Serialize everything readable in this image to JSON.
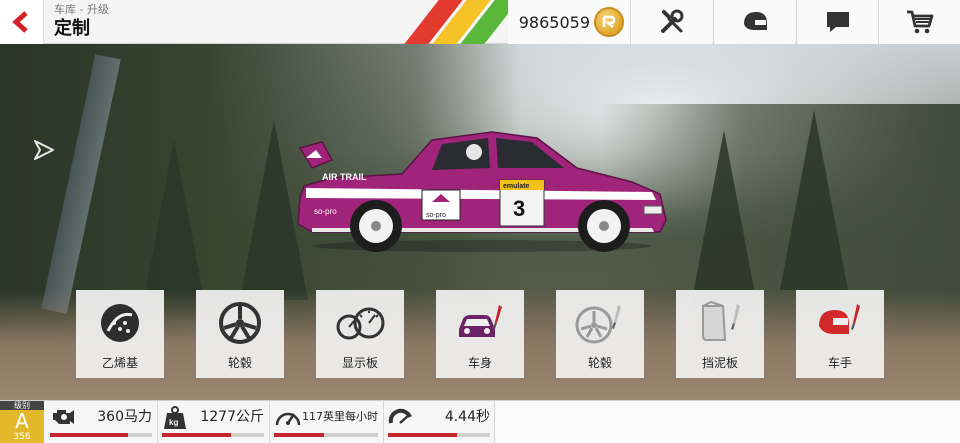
{
  "header": {
    "breadcrumb": "车库 - 升级",
    "title": "定制",
    "currency": "9865059",
    "stripe_colors": [
      "#e23a2f",
      "#f5c227",
      "#59b73a"
    ]
  },
  "nav": [
    {
      "name": "tools",
      "icon": "wrench-screwdriver-icon"
    },
    {
      "name": "driver",
      "icon": "helmet-icon"
    },
    {
      "name": "messages",
      "icon": "chat-bubble-icon"
    },
    {
      "name": "shop",
      "icon": "shopping-cart-icon"
    }
  ],
  "car": {
    "body_color": "#a0257a",
    "number": "3",
    "sponsor_top": "AIR TRAIL",
    "sponsor_door": "so-pro",
    "sponsor_rear": "so-pro",
    "sponsor_plate": "emulate"
  },
  "tiles": [
    {
      "label": "乙烯基",
      "icon": "vinyl-icon"
    },
    {
      "label": "轮毂",
      "icon": "wheel-rim-icon"
    },
    {
      "label": "显示板",
      "icon": "gauges-icon"
    },
    {
      "label": "车身",
      "icon": "car-paint-icon"
    },
    {
      "label": "轮毂",
      "icon": "wheel-paint-icon"
    },
    {
      "label": "挡泥板",
      "icon": "mudflap-paint-icon"
    },
    {
      "label": "车手",
      "icon": "helmet-paint-icon"
    }
  ],
  "stats": {
    "grade_header": "级别",
    "grade": "A",
    "pi": "356",
    "items": [
      {
        "label": "360马力",
        "icon": "engine-icon",
        "fill": 0.76
      },
      {
        "label": "1277公斤",
        "icon": "weight-icon",
        "fill": 0.68
      },
      {
        "label": "117英里每小时",
        "icon": "speedometer-icon",
        "fill": 0.48
      },
      {
        "label": "4.44秒",
        "icon": "acceleration-icon",
        "fill": 0.68
      }
    ]
  },
  "colors": {
    "accent": "#c5262c",
    "grade": "#e3b82a"
  }
}
